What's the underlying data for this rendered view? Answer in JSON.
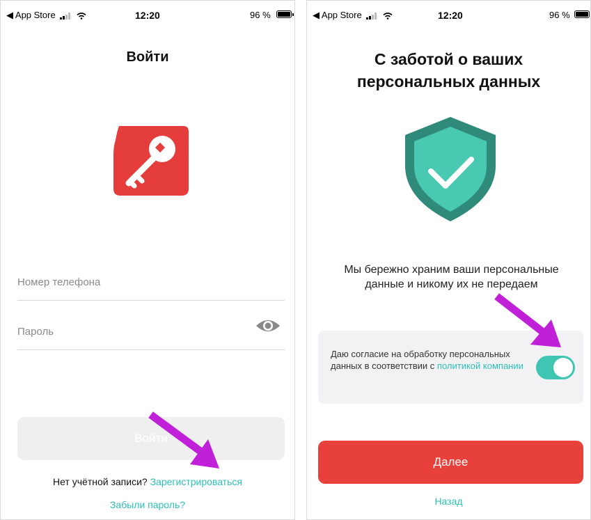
{
  "status_bar": {
    "carrier": "◀ App Store",
    "time": "12:20",
    "battery": "96 %"
  },
  "login_screen": {
    "title": "Войти",
    "phone_placeholder": "Номер телефона",
    "password_placeholder": "Пароль",
    "login_button": "Войти",
    "no_account": "Нет учётной записи?",
    "register_link": "Зарегистрироваться",
    "forgot_password": "Забыли пароль?"
  },
  "consent_screen": {
    "title_line1": "С заботой о ваших",
    "title_line2": "персональных данных",
    "info_line1": "Мы бережно храним ваши персональные",
    "info_line2": "данные и никому их не передаем",
    "consent_text": "Даю согласие на обработку персональных данных в соответствии с",
    "policy_link": "политикой компании",
    "consent_toggle_on": true,
    "next_button": "Далее",
    "back_link": "Назад"
  },
  "colors": {
    "accent": "#2dbfb8",
    "toggle": "#3ec6b3",
    "primary_button": "#e8413c",
    "logo_red": "#e53d3c",
    "shield_dark": "#2f8a7a",
    "shield_light": "#49c9b2",
    "annotation_arrow": "#c020d8"
  },
  "icons": {
    "logo": "key-icon",
    "visibility": "eye-icon",
    "privacy": "shield-check-icon"
  }
}
